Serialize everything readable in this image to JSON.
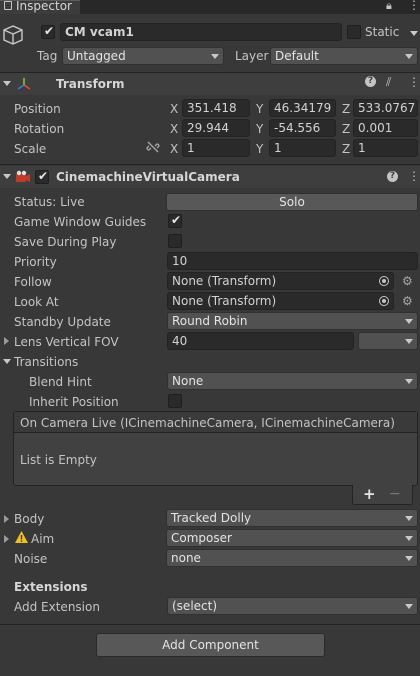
{
  "tab": {
    "title": "Inspector"
  },
  "gameobject": {
    "name": "CM vcam1",
    "static_label": "Static",
    "tag_label": "Tag",
    "tag_value": "Untagged",
    "layer_label": "Layer",
    "layer_value": "Default"
  },
  "transform": {
    "title": "Transform",
    "position_label": "Position",
    "rotation_label": "Rotation",
    "scale_label": "Scale",
    "x": "X",
    "y": "Y",
    "z": "Z",
    "position": [
      "351.418",
      "46.34179",
      "533.0767"
    ],
    "rotation": [
      "29.944",
      "-54.556",
      "0.001"
    ],
    "scale": [
      "1",
      "1",
      "1"
    ]
  },
  "vcam": {
    "title": "CinemachineVirtualCamera",
    "status_label": "Status: Live",
    "solo_label": "Solo",
    "guides_label": "Game Window Guides",
    "save_label": "Save During Play",
    "priority_label": "Priority",
    "priority_value": "10",
    "follow_label": "Follow",
    "follow_value": "None (Transform)",
    "lookat_label": "Look At",
    "lookat_value": "None (Transform)",
    "standby_label": "Standby Update",
    "standby_value": "Round Robin",
    "lens_label": "Lens Vertical FOV",
    "lens_value": "40",
    "transitions_label": "Transitions",
    "blend_label": "Blend Hint",
    "blend_value": "None",
    "inherit_label": "Inherit Position",
    "event_header": "On Camera Live (ICinemachineCamera, ICinemachineCamera)",
    "event_empty": "List is Empty",
    "add_symbol": "+",
    "remove_symbol": "−",
    "body_label": "Body",
    "body_value": "Tracked Dolly",
    "aim_label": "Aim",
    "aim_value": "Composer",
    "noise_label": "Noise",
    "noise_value": "none",
    "extensions_label": "Extensions",
    "add_ext_label": "Add Extension",
    "add_ext_value": "(select)"
  },
  "footer": {
    "add_component": "Add Component"
  },
  "colors": {
    "panel": "#383838",
    "field": "#2a2a2a",
    "dropdown": "#515151",
    "warning": "#f0c020"
  },
  "icons": [
    "lock-icon",
    "more-icon",
    "cube-icon",
    "help-icon",
    "settings-icon",
    "target-icon",
    "warning-icon",
    "camera-icon",
    "transform-icon"
  ]
}
